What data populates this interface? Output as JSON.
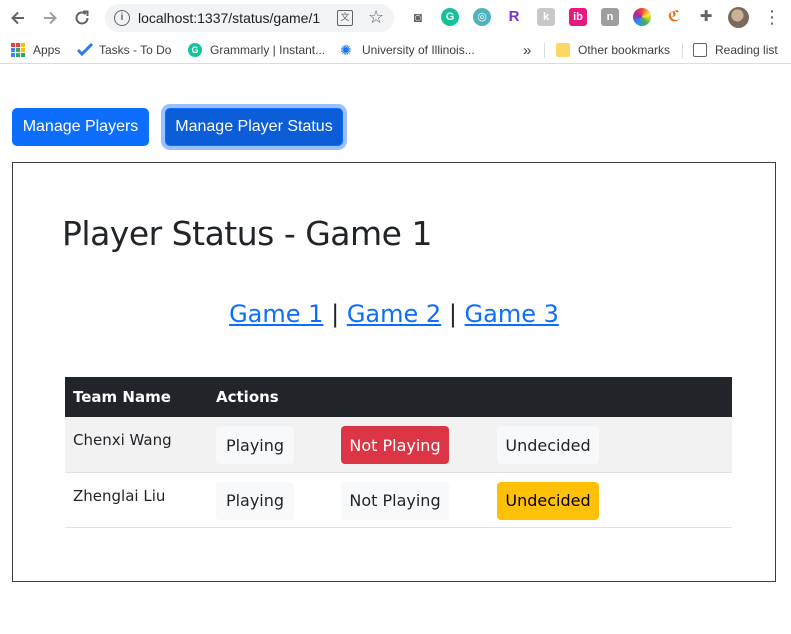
{
  "browser": {
    "url": "localhost:1337/status/game/1",
    "bookmarks": [
      {
        "label": "Apps"
      },
      {
        "label": "Tasks - To Do"
      },
      {
        "label": "Grammarly | Instant..."
      },
      {
        "label": "University of Illinois..."
      },
      {
        "label": "Other bookmarks"
      },
      {
        "label": "Reading list"
      }
    ],
    "overflow": "»"
  },
  "header": {
    "manage_players": "Manage Players",
    "manage_status": "Manage Player Status"
  },
  "page": {
    "title": "Player Status - Game 1",
    "game_links": [
      "Game 1",
      "Game 2",
      "Game 3"
    ],
    "separator": "|"
  },
  "table": {
    "columns": [
      "Team Name",
      "Actions"
    ],
    "status_options": [
      "Playing",
      "Not Playing",
      "Undecided"
    ],
    "rows": [
      {
        "name": "Chenxi Wang",
        "selected": "Not Playing"
      },
      {
        "name": "Zhenglai Liu",
        "selected": "Undecided"
      }
    ]
  },
  "colors": {
    "primary": "#0d6efd",
    "danger": "#dc3545",
    "warning": "#ffc107",
    "header_dark": "#212529"
  }
}
